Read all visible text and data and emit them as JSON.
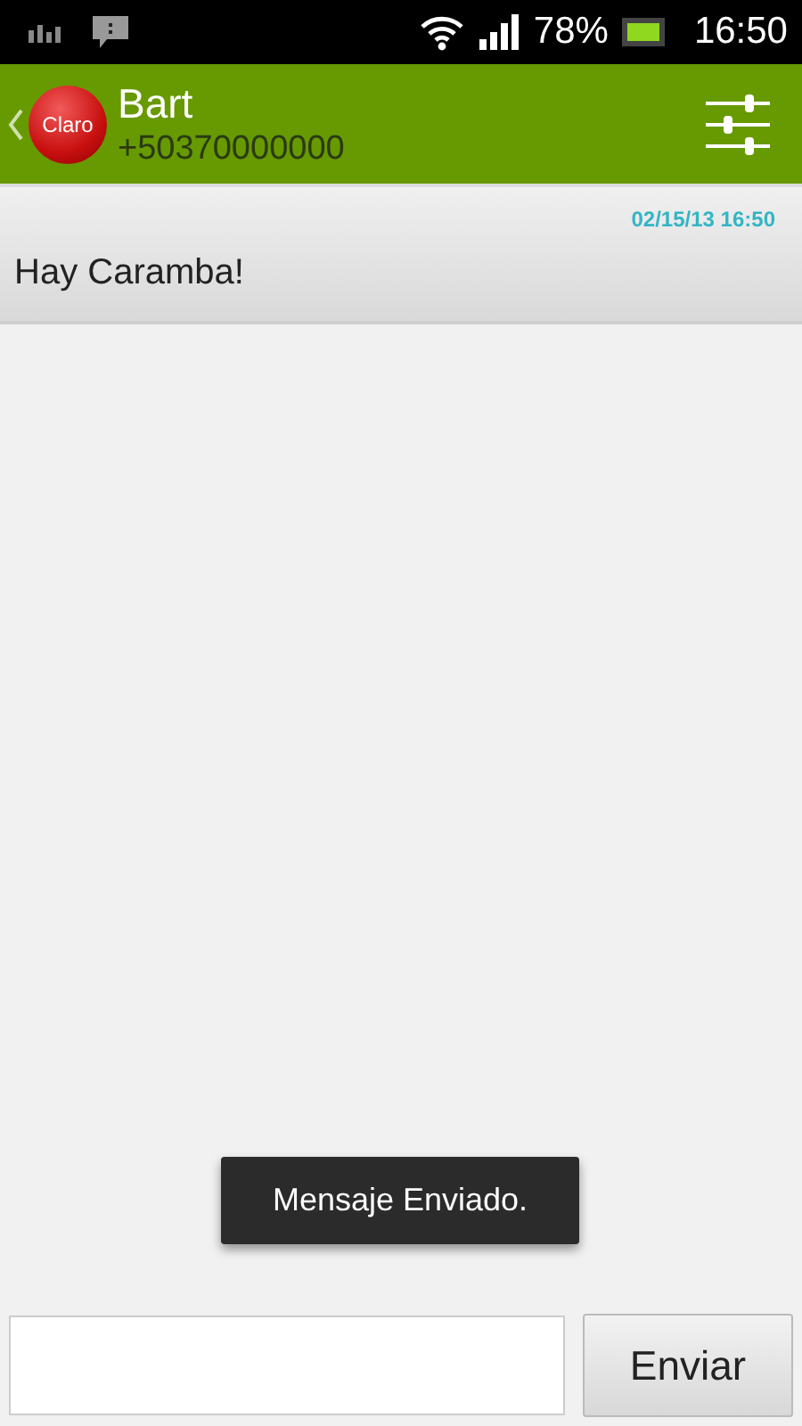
{
  "status_bar": {
    "battery": "78%",
    "time": "16:50"
  },
  "header": {
    "logo_text": "Claro",
    "contact_name": "Bart",
    "phone": "+50370000000"
  },
  "messages": [
    {
      "timestamp": "02/15/13 16:50",
      "text": "Hay Caramba!"
    }
  ],
  "toast": "Mensaje Enviado.",
  "composer": {
    "send_button": "Enviar"
  }
}
